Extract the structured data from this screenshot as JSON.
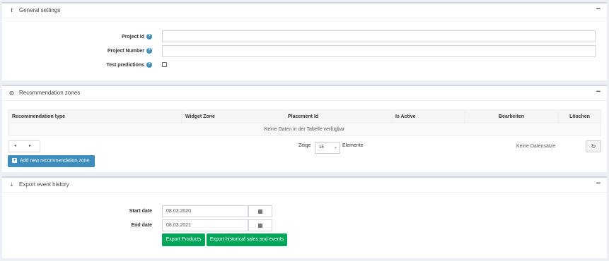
{
  "general": {
    "title": "General settings",
    "collapse": "−",
    "project_id_label": "Project Id",
    "project_number_label": "Project Number",
    "test_predictions_label": "Test predictions",
    "help": "?",
    "project_id_value": "",
    "project_number_value": ""
  },
  "zones": {
    "title": "Recommendation zones",
    "collapse": "−",
    "columns": [
      "Recommendation type",
      "Widget Zone",
      "Placement Id",
      "Is Active",
      "Bearbeiten",
      "Löschen"
    ],
    "empty": "Keine Daten in der Tabelle verfügbar",
    "prev": "◂",
    "next": "▸",
    "zeige": "Zeige",
    "page_size": "15",
    "elemente": "Elemente",
    "keine_datensatze": "Keine Datensätze",
    "add_button": "Add new recommendation zone"
  },
  "export": {
    "title": "Export event history",
    "collapse": "−",
    "start_label": "Start date",
    "start_value": "08.03.2020",
    "end_label": "End date",
    "end_value": "08.03.2021",
    "export_products": "Export Products",
    "export_history": "Export historical sales and events"
  },
  "colors": {
    "primary": "#3c8dbc",
    "success": "#00a65a"
  }
}
